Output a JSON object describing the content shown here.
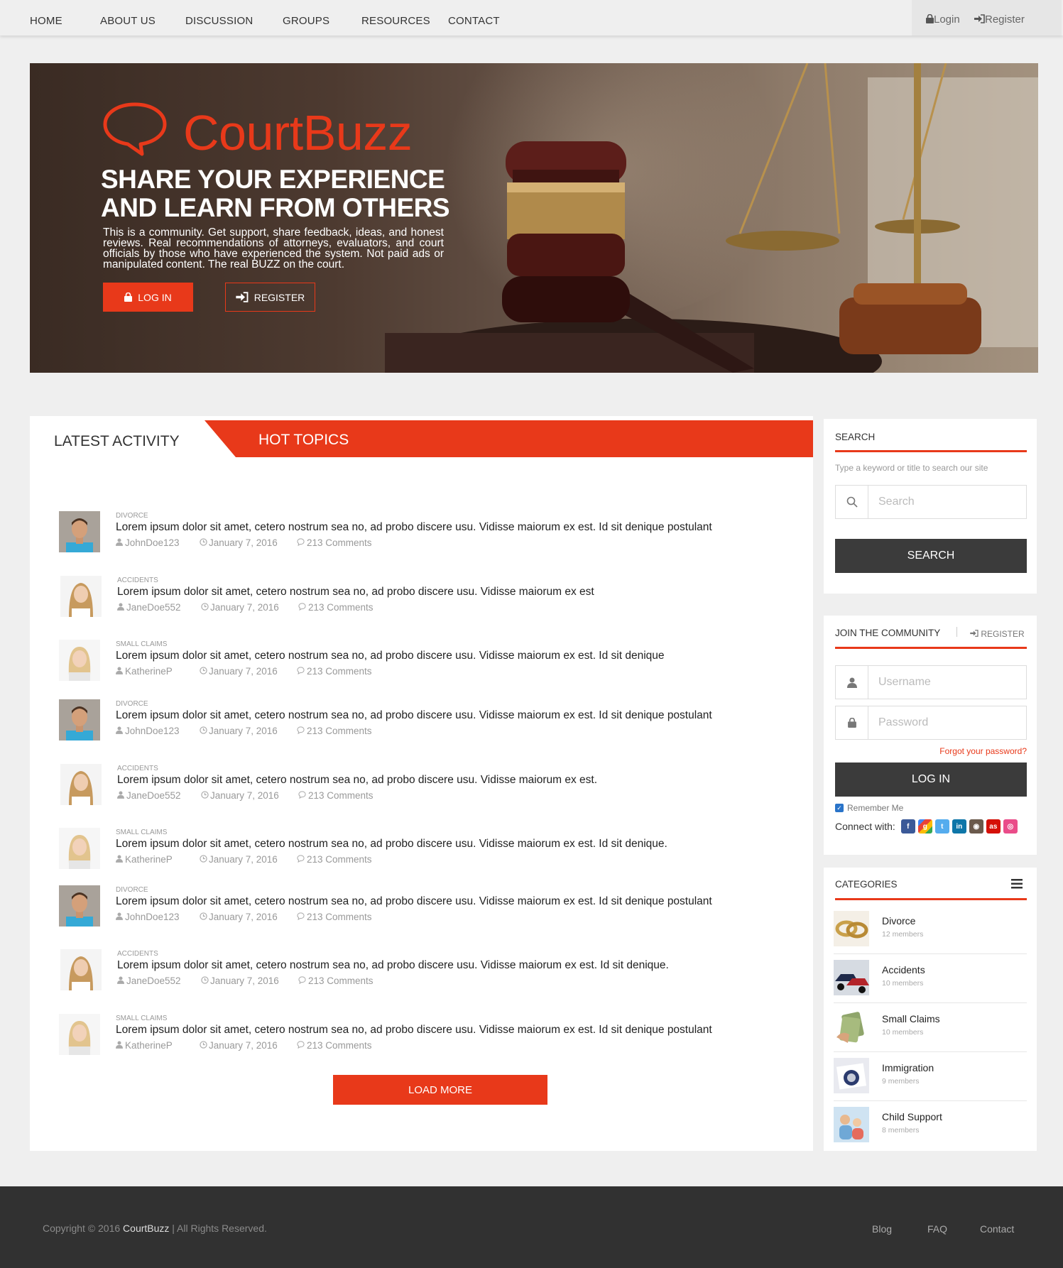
{
  "nav": {
    "items": [
      "HOME",
      "ABOUT US",
      "DISCUSSION",
      "GROUPS",
      "RESOURCES",
      "CONTACT"
    ],
    "login": "Login",
    "register": "Register"
  },
  "hero": {
    "brand": "CourtBuzz",
    "headline_1": "SHARE YOUR EXPERIENCE",
    "headline_2": "AND LEARN FROM OTHERS",
    "tagline": "This is a community. Get support, share feedback, ideas, and honest reviews. Real recommendations of attorneys, evaluators, and court officials by those who have experienced the system. Not paid ads or manipulated content. The real BUZZ on the court.",
    "login_btn": "LOG IN",
    "register_btn": "REGISTER",
    "accent": "#e8391a"
  },
  "tabs": {
    "latest": "LATEST ACTIVITY",
    "hot": "HOT TOPICS"
  },
  "activity": [
    {
      "category": "DIVORCE",
      "title": "Lorem ipsum dolor sit amet, cetero nostrum sea no, ad probo discere usu. Vidisse maiorum ex est. Id sit denique postulant",
      "user": "JohnDoe123",
      "date": "January 7, 2016",
      "comments": "213 Comments"
    },
    {
      "category": "ACCIDENTS",
      "title": "Lorem ipsum dolor sit amet, cetero nostrum sea no, ad probo discere usu. Vidisse maiorum ex est",
      "user": "JaneDoe552",
      "date": "January 7, 2016",
      "comments": "213 Comments"
    },
    {
      "category": "SMALL CLAIMS",
      "title": "Lorem ipsum dolor sit amet, cetero nostrum sea no, ad probo discere usu. Vidisse maiorum ex est. Id sit denique",
      "user": "KatherineP",
      "date": "January 7, 2016",
      "comments": "213 Comments"
    },
    {
      "category": "DIVORCE",
      "title": "Lorem ipsum dolor sit amet, cetero nostrum sea no, ad probo discere usu. Vidisse maiorum ex est. Id sit denique postulant",
      "user": "JohnDoe123",
      "date": "January 7, 2016",
      "comments": "213 Comments"
    },
    {
      "category": "ACCIDENTS",
      "title": "Lorem ipsum dolor sit amet, cetero nostrum sea no, ad probo discere usu. Vidisse maiorum ex est.",
      "user": "JaneDoe552",
      "date": "January 7, 2016",
      "comments": "213 Comments"
    },
    {
      "category": "SMALL CLAIMS",
      "title": "Lorem ipsum dolor sit amet, cetero nostrum sea no, ad probo discere usu. Vidisse maiorum ex est. Id sit denique.",
      "user": "KatherineP",
      "date": "January 7, 2016",
      "comments": "213 Comments"
    },
    {
      "category": "DIVORCE",
      "title": "Lorem ipsum dolor sit amet, cetero nostrum sea no, ad probo discere usu. Vidisse maiorum ex est. Id sit denique postulant",
      "user": "JohnDoe123",
      "date": "January 7, 2016",
      "comments": "213 Comments"
    },
    {
      "category": "ACCIDENTS",
      "title": "Lorem ipsum dolor sit amet, cetero nostrum sea no, ad probo discere usu. Vidisse maiorum ex est. Id sit denique.",
      "user": "JaneDoe552",
      "date": "January 7, 2016",
      "comments": "213 Comments"
    },
    {
      "category": "SMALL CLAIMS",
      "title": "Lorem ipsum dolor sit amet, cetero nostrum sea no, ad probo discere usu. Vidisse maiorum ex est. Id sit denique postulant",
      "user": "KatherineP",
      "date": "January 7, 2016",
      "comments": "213 Comments"
    }
  ],
  "load_more": "LOAD MORE",
  "search": {
    "title": "SEARCH",
    "hint": "Type a keyword or title to  search our site",
    "placeholder": "Search",
    "button": "SEARCH"
  },
  "join": {
    "title": "JOIN THE COMMUNITY",
    "register": "REGISTER",
    "username_placeholder": "Username",
    "password_placeholder": "Password",
    "forgot": "Forgot your password?",
    "login_btn": "LOG IN",
    "remember": "Remember Me",
    "connect": "Connect with:",
    "social": [
      "facebook-icon",
      "google-icon",
      "twitter-icon",
      "linkedin-icon",
      "instagram-icon",
      "lastfm-icon",
      "dribbble-icon"
    ]
  },
  "categories": {
    "title": "CATEGORIES",
    "items": [
      {
        "name": "Divorce",
        "members": "12 members"
      },
      {
        "name": "Accidents",
        "members": "10 members"
      },
      {
        "name": "Small Claims",
        "members": "10 members"
      },
      {
        "name": "Immigration",
        "members": "9 members"
      },
      {
        "name": "Child Support",
        "members": "8 members"
      }
    ]
  },
  "footer": {
    "copyright_prefix": "Copyright © 2016 ",
    "brand": "CourtBuzz",
    "rights": "  | All Rights Reserved.",
    "links": [
      "Blog",
      "FAQ",
      "Contact"
    ]
  }
}
